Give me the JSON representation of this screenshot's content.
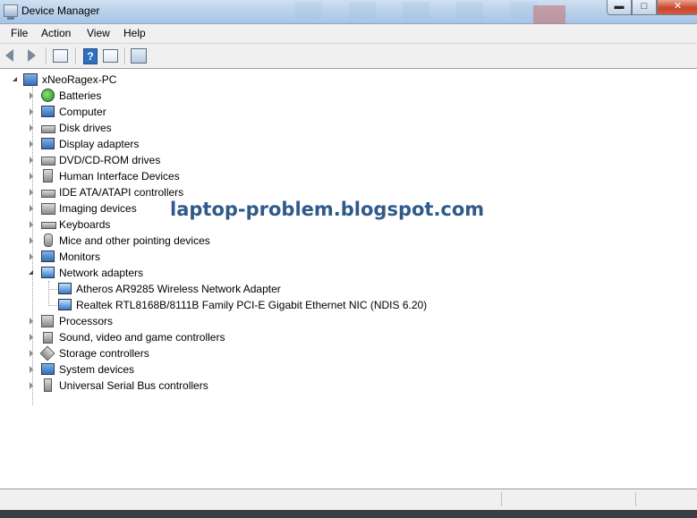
{
  "window": {
    "title": "Device Manager",
    "controls": {
      "minimize": "▬",
      "maximize": "□",
      "close": "✕"
    }
  },
  "menu": {
    "items": [
      "File",
      "Action",
      "View",
      "Help"
    ]
  },
  "toolbar": {
    "buttons": [
      "back-icon",
      "forward-icon",
      "properties-icon",
      "help-icon",
      "view-icon",
      "scan-hardware-icon"
    ]
  },
  "tree": {
    "root": "xNeoRagex-PC",
    "categories": [
      {
        "label": "Batteries",
        "icon": "battery-icon",
        "expanded": false
      },
      {
        "label": "Computer",
        "icon": "computer-icon",
        "expanded": false
      },
      {
        "label": "Disk drives",
        "icon": "disk-drive-icon",
        "expanded": false
      },
      {
        "label": "Display adapters",
        "icon": "display-adapter-icon",
        "expanded": false
      },
      {
        "label": "DVD/CD-ROM drives",
        "icon": "dvd-drive-icon",
        "expanded": false
      },
      {
        "label": "Human Interface Devices",
        "icon": "hid-icon",
        "expanded": false
      },
      {
        "label": "IDE ATA/ATAPI controllers",
        "icon": "ide-controller-icon",
        "expanded": false
      },
      {
        "label": "Imaging devices",
        "icon": "camera-icon",
        "expanded": false
      },
      {
        "label": "Keyboards",
        "icon": "keyboard-icon",
        "expanded": false
      },
      {
        "label": "Mice and other pointing devices",
        "icon": "mouse-icon",
        "expanded": false
      },
      {
        "label": "Monitors",
        "icon": "monitor-icon",
        "expanded": false
      },
      {
        "label": "Network adapters",
        "icon": "network-adapter-icon",
        "expanded": true,
        "children": [
          {
            "label": "Atheros AR9285 Wireless Network Adapter",
            "icon": "network-adapter-icon"
          },
          {
            "label": "Realtek RTL8168B/8111B Family PCI-E Gigabit Ethernet NIC (NDIS 6.20)",
            "icon": "network-adapter-warning-icon"
          }
        ]
      },
      {
        "label": "Processors",
        "icon": "processor-icon",
        "expanded": false
      },
      {
        "label": "Sound, video and game controllers",
        "icon": "speaker-icon",
        "expanded": false
      },
      {
        "label": "Storage controllers",
        "icon": "storage-controller-icon",
        "expanded": false
      },
      {
        "label": "System devices",
        "icon": "system-devices-icon",
        "expanded": false
      },
      {
        "label": "Universal Serial Bus controllers",
        "icon": "usb-icon",
        "expanded": false
      }
    ]
  },
  "watermark": "laptop-problem.blogspot.com",
  "colors": {
    "titlebar": "#b9d1ea",
    "menubar": "#f0f0f0",
    "watermark": "#2f5a8a",
    "close_button": "#c8472b"
  }
}
